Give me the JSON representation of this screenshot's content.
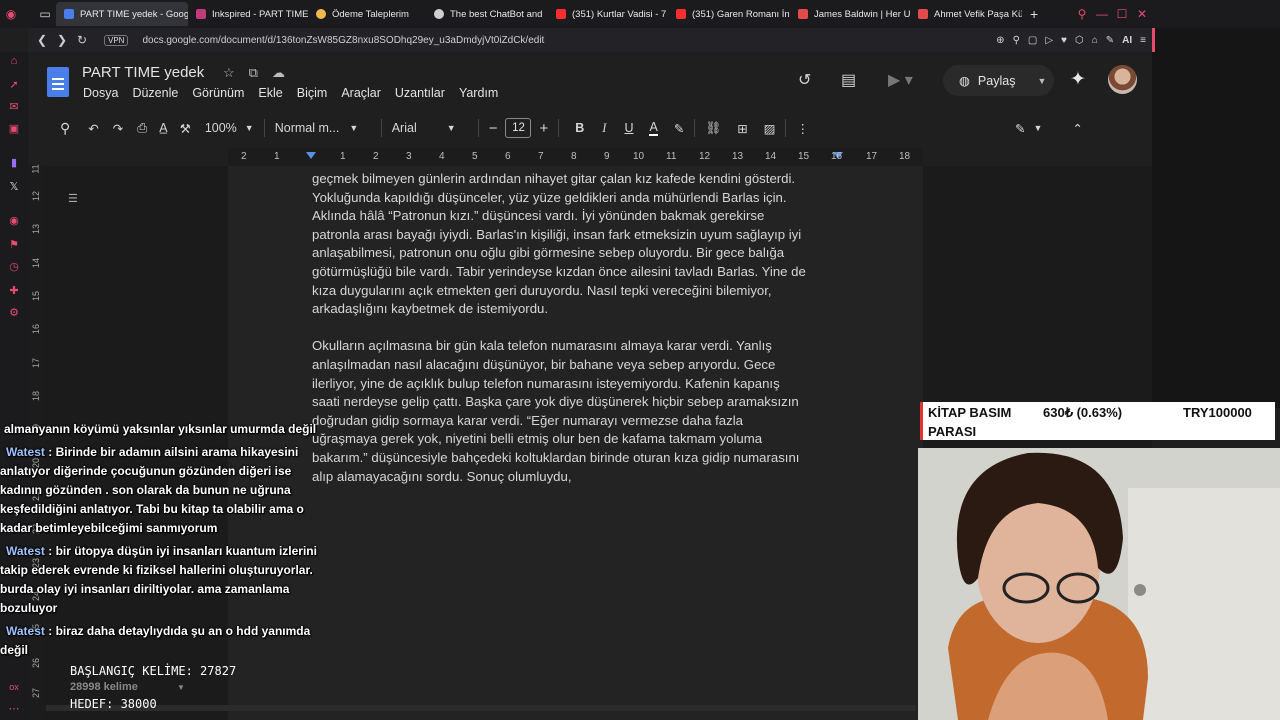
{
  "browser": {
    "tabs": [
      {
        "label": "PART TIME yedek - Googl",
        "color": "#4a7ee8",
        "active": true
      },
      {
        "label": "Inkspired - PART TIME",
        "color": "#c23a7a"
      },
      {
        "label": "Ödeme Taleplerim",
        "color": "#f2b84b"
      },
      {
        "label": "The best ChatBot and",
        "color": "#cfcfcf"
      },
      {
        "label": "(351) Kurtlar Vadisi - 7",
        "color": "#ff2d2d"
      },
      {
        "label": "(351) Garen Romanı İn",
        "color": "#ff2d2d"
      },
      {
        "label": "James Baldwin | Her U",
        "color": "#e34b4b"
      },
      {
        "label": "Ahmet Vefik Paşa Kütü",
        "color": "#e34b4b"
      }
    ],
    "new_tab": "+",
    "url": "docs.google.com/document/d/136tonZsW85GZ8nxu8SODhq29ey_u3aDmdyjVt0iZdCk/edit",
    "vpn": "VPN",
    "ai_label": "AI"
  },
  "docs": {
    "title": "PART TIME  yedek",
    "menu": [
      "Dosya",
      "Düzenle",
      "Görünüm",
      "Ekle",
      "Biçim",
      "Araçlar",
      "Uzantılar",
      "Yardım"
    ],
    "share_label": "Paylaş",
    "toolbar": {
      "zoom": "100%",
      "style": "Normal m...",
      "font": "Arial",
      "font_size": "12"
    },
    "ruler_labels": [
      "2",
      "1",
      "1",
      "2",
      "3",
      "4",
      "5",
      "6",
      "7",
      "8",
      "9",
      "10",
      "11",
      "12",
      "13",
      "14",
      "15",
      "16",
      "17",
      "18"
    ],
    "vruler_labels": [
      "11",
      "12",
      "13",
      "14",
      "15",
      "16",
      "17",
      "18",
      "19",
      "20",
      "21",
      "22",
      "23",
      "24",
      "25",
      "26",
      "27"
    ],
    "paragraph1": [
      "geçmek bilmeyen günlerin ardından nihayet gitar çalan kız kafede kendini gösterdi.",
      "Yokluğunda kapıldığı düşünceler, yüz yüze geldikleri anda mühürlendi Barlas için.",
      "Aklında hâlâ “Patronun kızı.” düşüncesi vardı. İyi yönünden bakmak gerekirse",
      "patronla arası bayağı iyiydi. Barlas'ın kişiliği, insan fark etmeksizin uyum sağlayıp iyi",
      "anlaşabilmesi, patronun onu oğlu gibi görmesine sebep oluyordu. Bir gece balığa",
      "götürmüşlüğü bile vardı. Tabir yerindeyse kızdan önce ailesini tavladı Barlas. Yine de",
      "kıza duygularını açık etmekten geri duruyordu. Nasıl tepki vereceğini bilemiyor,",
      "arkadaşlığını kaybetmek de istemiyordu."
    ],
    "paragraph2": [
      "Okulların açılmasına bir gün kala telefon numarasını almaya karar verdi. Yanlış",
      "anlaşılmadan nasıl alacağını düşünüyor, bir bahane veya sebep arıyordu. Gece",
      "ilerliyor, yine de açıklık bulup telefon numarasını isteyemiyordu. Kafenin kapanış",
      "saati nerdeyse gelip çattı. Başka çare yok diye düşünerek hiçbir sebep aramaksızın",
      "doğrudan gidip sormaya karar verdi. “Eğer numarayı vermezse daha fazla",
      "uğraşmaya gerek yok, niyetini belli etmiş olur ben de kafama takmam yoluma",
      "bakarım.” düşüncesiyle bahçedeki koltuklardan birinde oturan kıza gidip numarasını",
      "alıp alamayacağını sordu. Sonuç olumluydu,"
    ]
  },
  "stream": {
    "chat": [
      {
        "name": "",
        "text": "almanyanın köyümü yaksınlar yıksınlar umurmda değil"
      },
      {
        "name": "Watest",
        "text": "Birinde bir adamın ailsini arama hikayesini anlatıyor diğerinde çocuğunun gözünden diğeri ise kadının gözünden . son olarak da bunun ne uğruna keşfedildiğini anlatıyor. Tabi bu kitap ta olabilir ama o kadar betimleyebilceğimi sanmıyorum"
      },
      {
        "name": "Watest",
        "text": "bir ütopya düşün iyi insanları kuantum izlerini takip ederek evrende ki fiziksel hallerini oluşturuyorlar. burda olay iyi insanları diriltiyolar. ama zamanlama bozuluyor"
      },
      {
        "name": "Watest",
        "text": "biraz daha detaylıydıda şu an o hdd yanımda değil"
      }
    ],
    "start_words": "BAŞLANGIÇ KELİME: 27827",
    "current_words": "28998 kelime",
    "target_words": "HEDEF: 38000",
    "goal": {
      "label": "KİTAP BASIM PARASI",
      "amount": "630₺ (0.63%)",
      "target": "TRY100000"
    }
  }
}
